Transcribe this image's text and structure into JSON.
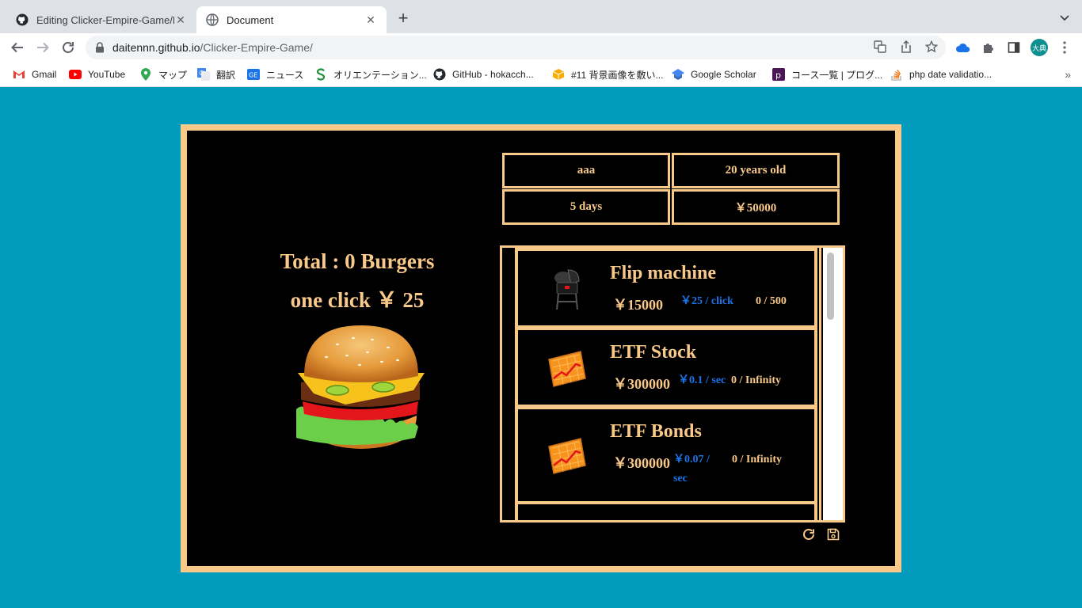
{
  "browser": {
    "tabs": [
      {
        "title": "Editing Clicker-Empire-Game/R",
        "active": false
      },
      {
        "title": "Document",
        "active": true
      }
    ],
    "url_host": "daitennn.github.io",
    "url_path": "/Clicker-Empire-Game/",
    "avatar_text": "大典",
    "bookmarks": [
      "Gmail",
      "YouTube",
      "マップ",
      "翻訳",
      "ニュース",
      "オリエンテーション...",
      "GitHub - hokacch...",
      "#11 背景画像を敷い...",
      "Google Scholar",
      "コース一覧 | プログ...",
      "php date validatio..."
    ]
  },
  "game": {
    "total_text": "Total : 0 Burgers",
    "per_click_text": "one click ￥ 25",
    "player": {
      "name": "aaa",
      "age": "20 years old",
      "days": "5 days",
      "money": "￥50000"
    },
    "items": [
      {
        "name": "Flip machine",
        "price": "￥15000",
        "rate": "￥25 / click",
        "owned": "0 / 500",
        "icon": "grill-icon"
      },
      {
        "name": "ETF Stock",
        "price": "￥300000",
        "rate": "￥0.1 / sec",
        "owned": "0 / Infinity",
        "icon": "stock-chart-icon"
      },
      {
        "name": "ETF Bonds",
        "price": "￥300000",
        "rate": "￥0.07 / sec",
        "owned": "0 / Infinity",
        "icon": "stock-chart-icon"
      }
    ],
    "colors": {
      "accent": "#f9c98a",
      "rate": "#1a73e8",
      "page_bg": "#039bbd"
    }
  }
}
